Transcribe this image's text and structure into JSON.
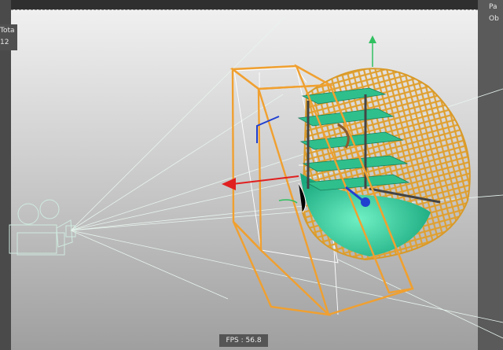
{
  "hud_left": {
    "line1": "Tota",
    "line2": "12"
  },
  "hud_right": {
    "line1": "Pa",
    "line2": "Ob"
  },
  "fps_label": "FPS : 56.8",
  "colors": {
    "selection_box": "#f0a030",
    "geodesic_lattice": "#e0a030",
    "shell": "#3cc7a0",
    "grid_lines": "#ffffff",
    "camera_lines": "#dff2ea",
    "axis_x": "#e02020",
    "axis_y": "#30c060",
    "axis_z": "#2040d0"
  },
  "icons": {
    "camera": "camera-icon",
    "gizmo": "transform-gizmo-icon"
  }
}
